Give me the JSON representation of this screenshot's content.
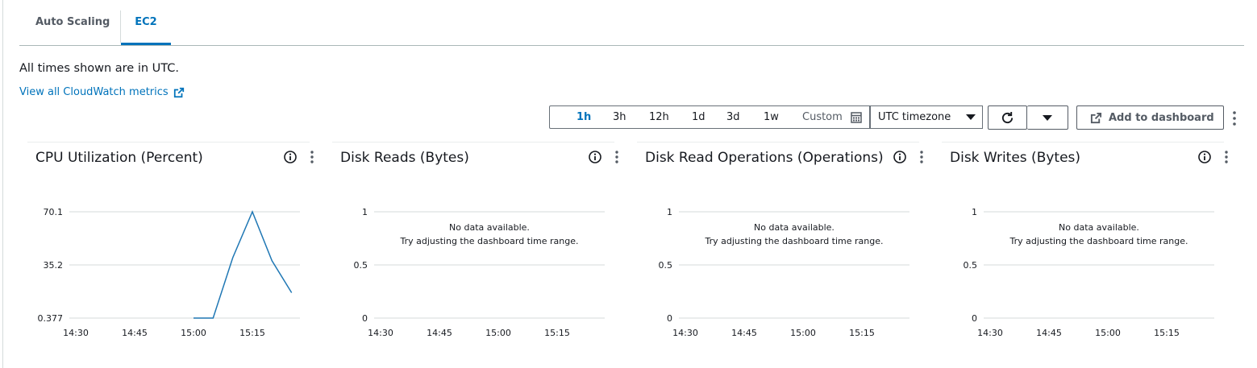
{
  "tabs": [
    {
      "label": "Auto Scaling",
      "active": false
    },
    {
      "label": "EC2",
      "active": true
    }
  ],
  "utc_note": "All times shown are in UTC.",
  "cloudwatch_link": "View all CloudWatch metrics",
  "toolbar": {
    "ranges": [
      {
        "label": "1h",
        "active": true
      },
      {
        "label": "3h",
        "active": false
      },
      {
        "label": "12h",
        "active": false
      },
      {
        "label": "1d",
        "active": false
      },
      {
        "label": "3d",
        "active": false
      },
      {
        "label": "1w",
        "active": false
      }
    ],
    "custom_label": "Custom",
    "timezone": "UTC timezone",
    "add_to_dashboard": "Add to dashboard"
  },
  "colors": {
    "accent": "#0073bb",
    "line": "#1f77b4",
    "grid": "#d5dbdb"
  },
  "widgets": [
    {
      "title": "CPU Utilization (Percent)"
    },
    {
      "title": "Disk Reads (Bytes)",
      "nodata_line1": "No data available.",
      "nodata_line2": "Try adjusting the dashboard time range."
    },
    {
      "title": "Disk Read Operations (Operations)",
      "nodata_line1": "No data available.",
      "nodata_line2": "Try adjusting the dashboard time range."
    },
    {
      "title": "Disk Writes (Bytes)",
      "nodata_line1": "No data available.",
      "nodata_line2": "Try adjusting the dashboard time range."
    }
  ],
  "chart_data": [
    {
      "type": "line",
      "title": "CPU Utilization (Percent)",
      "x": [
        "14:30",
        "14:35",
        "14:40",
        "14:45",
        "14:50",
        "14:55",
        "15:00",
        "15:05",
        "15:10",
        "15:15",
        "15:20",
        "15:25"
      ],
      "x_ticks": [
        "14:30",
        "14:45",
        "15:00",
        "15:15"
      ],
      "y_ticks": [
        "70.1",
        "35.2",
        "0.377"
      ],
      "ylim": [
        0.377,
        70.1
      ],
      "series": [
        {
          "values": [
            null,
            null,
            null,
            null,
            null,
            null,
            0.377,
            0.377,
            40,
            70.1,
            38,
            17
          ]
        }
      ]
    },
    {
      "type": "line",
      "title": "Disk Reads (Bytes)",
      "x_ticks": [
        "14:30",
        "14:45",
        "15:00",
        "15:15"
      ],
      "y_ticks": [
        "1",
        "0.5",
        "0"
      ],
      "ylim": [
        0,
        1
      ],
      "series": []
    },
    {
      "type": "line",
      "title": "Disk Read Operations (Operations)",
      "x_ticks": [
        "14:30",
        "14:45",
        "15:00",
        "15:15"
      ],
      "y_ticks": [
        "1",
        "0.5",
        "0"
      ],
      "ylim": [
        0,
        1
      ],
      "series": []
    },
    {
      "type": "line",
      "title": "Disk Writes (Bytes)",
      "x_ticks": [
        "14:30",
        "14:45",
        "15:00",
        "15:15"
      ],
      "y_ticks": [
        "1",
        "0.5",
        "0"
      ],
      "ylim": [
        0,
        1
      ],
      "series": []
    }
  ]
}
